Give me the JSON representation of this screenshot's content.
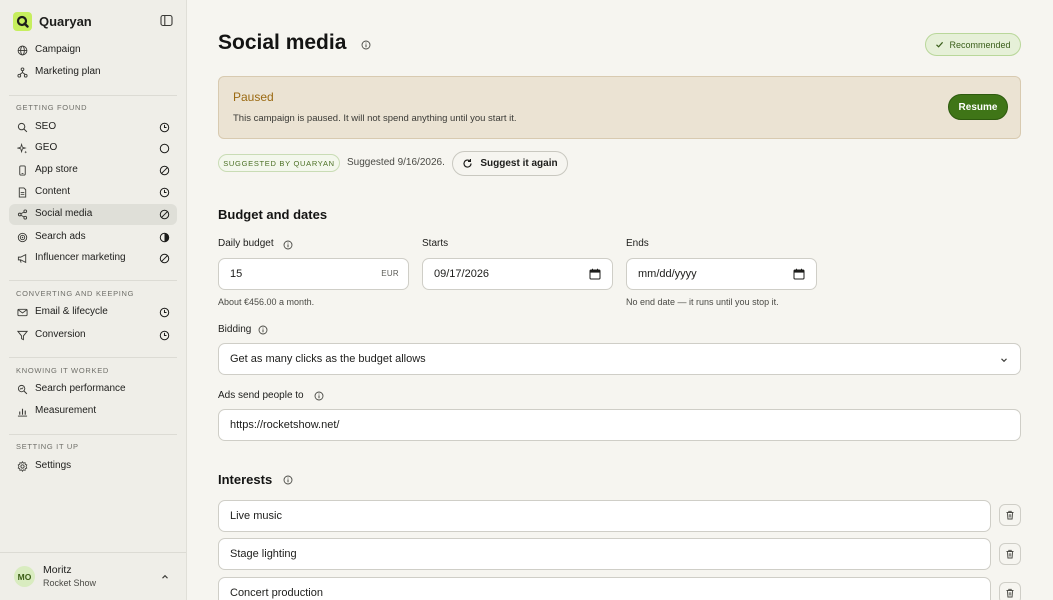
{
  "app": {
    "name": "Quaryan"
  },
  "sidebar": {
    "top_items": [
      {
        "label": "Campaign",
        "icon": "globe-icon"
      },
      {
        "label": "Marketing plan",
        "icon": "branch-icon"
      }
    ],
    "sections": [
      {
        "title": "GETTING FOUND",
        "items": [
          {
            "label": "SEO",
            "icon": "search-icon",
            "status": "clock"
          },
          {
            "label": "GEO",
            "icon": "sparkle-icon",
            "status": "circle"
          },
          {
            "label": "App store",
            "icon": "phone-icon",
            "status": "blocked"
          },
          {
            "label": "Content",
            "icon": "document-icon",
            "status": "clock"
          },
          {
            "label": "Social media",
            "icon": "share-icon",
            "status": "blocked",
            "active": true
          },
          {
            "label": "Search ads",
            "icon": "target-icon",
            "status": "half"
          },
          {
            "label": "Influencer marketing",
            "icon": "megaphone-icon",
            "status": "blocked"
          }
        ]
      },
      {
        "title": "CONVERTING AND KEEPING",
        "items": [
          {
            "label": "Email & lifecycle",
            "icon": "mail-icon",
            "status": "clock"
          },
          {
            "label": "Conversion",
            "icon": "funnel-icon",
            "status": "clock"
          }
        ]
      },
      {
        "title": "KNOWING IT WORKED",
        "items": [
          {
            "label": "Search performance",
            "icon": "chart-search-icon"
          },
          {
            "label": "Measurement",
            "icon": "bar-chart-icon"
          }
        ]
      },
      {
        "title": "SETTING IT UP",
        "items": [
          {
            "label": "Settings",
            "icon": "gear-icon"
          }
        ]
      }
    ],
    "user": {
      "initials": "MO",
      "name": "Moritz",
      "org": "Rocket Show"
    }
  },
  "page": {
    "title": "Social media",
    "recommended_label": "Recommended",
    "paused": {
      "title": "Paused",
      "text": "This campaign is paused. It will not spend anything until you start it.",
      "resume_label": "Resume"
    },
    "suggestion": {
      "badge": "SUGGESTED BY QUARYAN",
      "date_text": "Suggested 9/16/2026.",
      "button_label": "Suggest it again"
    },
    "budget": {
      "heading": "Budget and dates",
      "daily_budget_label": "Daily budget",
      "daily_budget_value": "15",
      "currency": "EUR",
      "daily_budget_help": "About €456.00 a month.",
      "starts_label": "Starts",
      "starts_value": "09/17/2026",
      "ends_label": "Ends",
      "ends_placeholder": "mm/dd/yyyy",
      "ends_help": "No end date — it runs until you stop it.",
      "bidding_label": "Bidding",
      "bidding_value": "Get as many clicks as the budget allows",
      "ads_send_label": "Ads send people to",
      "ads_send_value": "https://rocketshow.net/"
    },
    "interests": {
      "heading": "Interests",
      "items": [
        "Live music",
        "Stage lighting",
        "Concert production"
      ]
    }
  },
  "colors": {
    "accent_green": "#3f7517",
    "logo_lime": "#c6ee5e",
    "paused_bg": "#ebe3d3",
    "paused_title": "#9b6a12"
  }
}
